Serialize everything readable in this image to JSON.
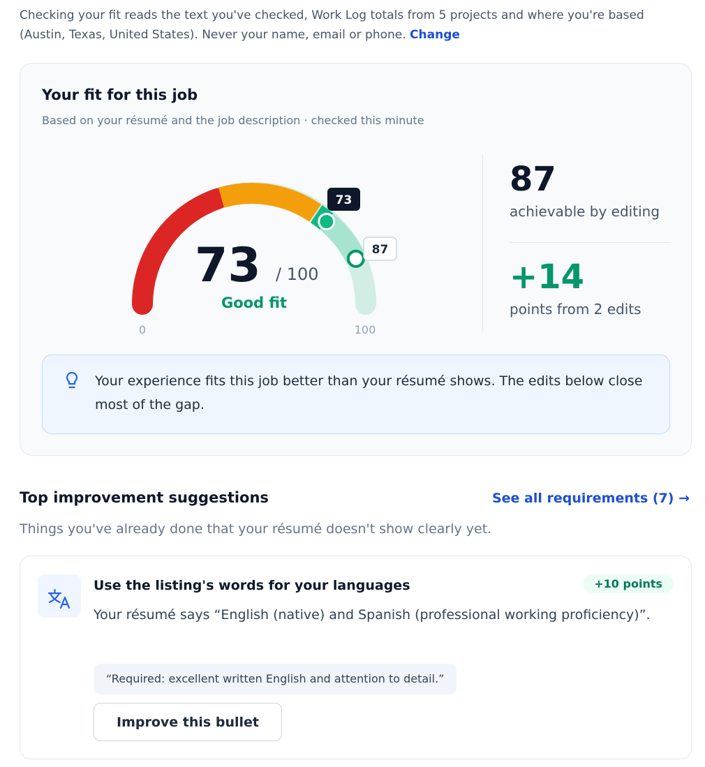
{
  "privacy": {
    "text": "Checking your fit reads the text you've checked, Work Log totals from 5 projects and where you're based (Austin, Texas, United States). Never your name, email or phone.",
    "change_link": "Change"
  },
  "fit": {
    "title": "Your fit for this job",
    "subtitle": "Based on your résumé and the job description · checked this minute",
    "score": "73",
    "score_max": "/ 100",
    "rating": "Good fit",
    "current_marker": "73",
    "target_marker": "87",
    "scale_min": "0",
    "scale_max": "100",
    "current_value": 73,
    "target_value": 87,
    "achievable": "87",
    "achievable_label": "achievable by editing",
    "gain": "+14",
    "gain_label": "points from 2 edits",
    "insight": "Your experience fits this job better than your résumé shows. The edits below close most of the gap.",
    "colors": {
      "red": "#dc2626",
      "orange": "#f59e0b",
      "green": "#10b981",
      "mint": "#a7e3cf",
      "track": "#d1ede4"
    }
  },
  "suggestions": {
    "title": "Top improvement suggestions",
    "see_all": "See all requirements (7) →",
    "subtitle": "Things you've already done that your résumé doesn't show clearly yet.",
    "items": [
      {
        "icon": "translate-icon",
        "title": "Use the listing's words for your languages",
        "points": "+10 points",
        "body": "Your résumé says “English (native) and Spanish (professional working proficiency)”.",
        "quote": "“Required: excellent written English and attention to detail.”",
        "button": "Improve this bullet"
      }
    ]
  }
}
